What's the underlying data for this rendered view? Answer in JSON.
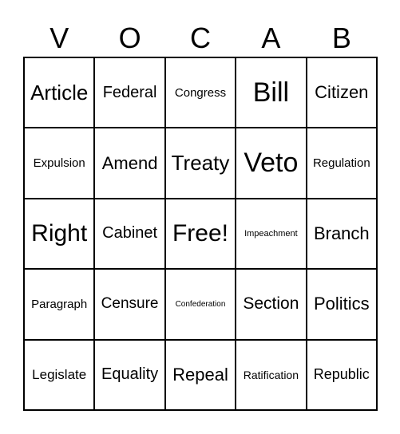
{
  "header": {
    "letters": [
      "V",
      "O",
      "C",
      "A",
      "B"
    ]
  },
  "cells": [
    "Article",
    "Federal",
    "Congress",
    "Bill",
    "Citizen",
    "Expulsion",
    "Amend",
    "Treaty",
    "Veto",
    "Regulation",
    "Right",
    "Cabinet",
    "Free!",
    "Impeachment",
    "Branch",
    "Paragraph",
    "Censure",
    "Confederation",
    "Section",
    "Politics",
    "Legislate",
    "Equality",
    "Repeal",
    "Ratification",
    "Republic"
  ]
}
